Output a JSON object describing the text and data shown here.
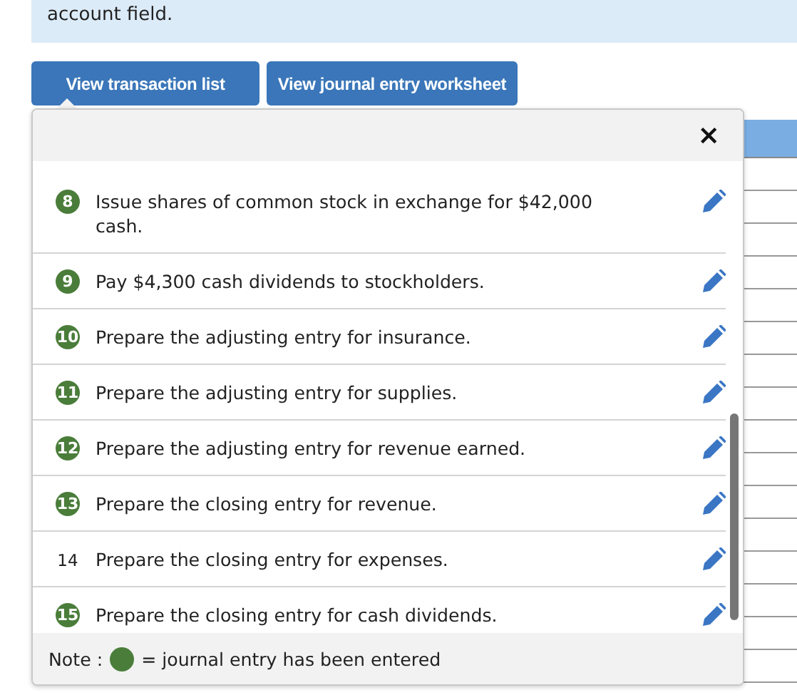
{
  "instructions": {
    "text": "account field."
  },
  "buttons": [
    {
      "label": "View transaction list",
      "selected": true
    },
    {
      "label": "View journal entry worksheet",
      "selected": false
    }
  ],
  "popup": {
    "close": "×",
    "transactions": [
      {
        "number": "8",
        "text": "Issue shares of common stock in exchange for $42,000 cash.",
        "entered": true
      },
      {
        "number": "9",
        "text": "Pay $4,300 cash dividends to stockholders.",
        "entered": true
      },
      {
        "number": "10",
        "text": "Prepare the adjusting entry for insurance.",
        "entered": true
      },
      {
        "number": "11",
        "text": "Prepare the adjusting entry for supplies.",
        "entered": true
      },
      {
        "number": "12",
        "text": "Prepare the adjusting entry for revenue earned.",
        "entered": true
      },
      {
        "number": "13",
        "text": "Prepare the closing entry for revenue.",
        "entered": true
      },
      {
        "number": "14",
        "text": "Prepare the closing entry for expenses.",
        "entered": false
      },
      {
        "number": "15",
        "text": "Prepare the closing entry for cash dividends.",
        "entered": true
      }
    ],
    "note": {
      "label": "Note :",
      "color": "#4a7d3a",
      "text": "= journal entry has been entered"
    }
  }
}
